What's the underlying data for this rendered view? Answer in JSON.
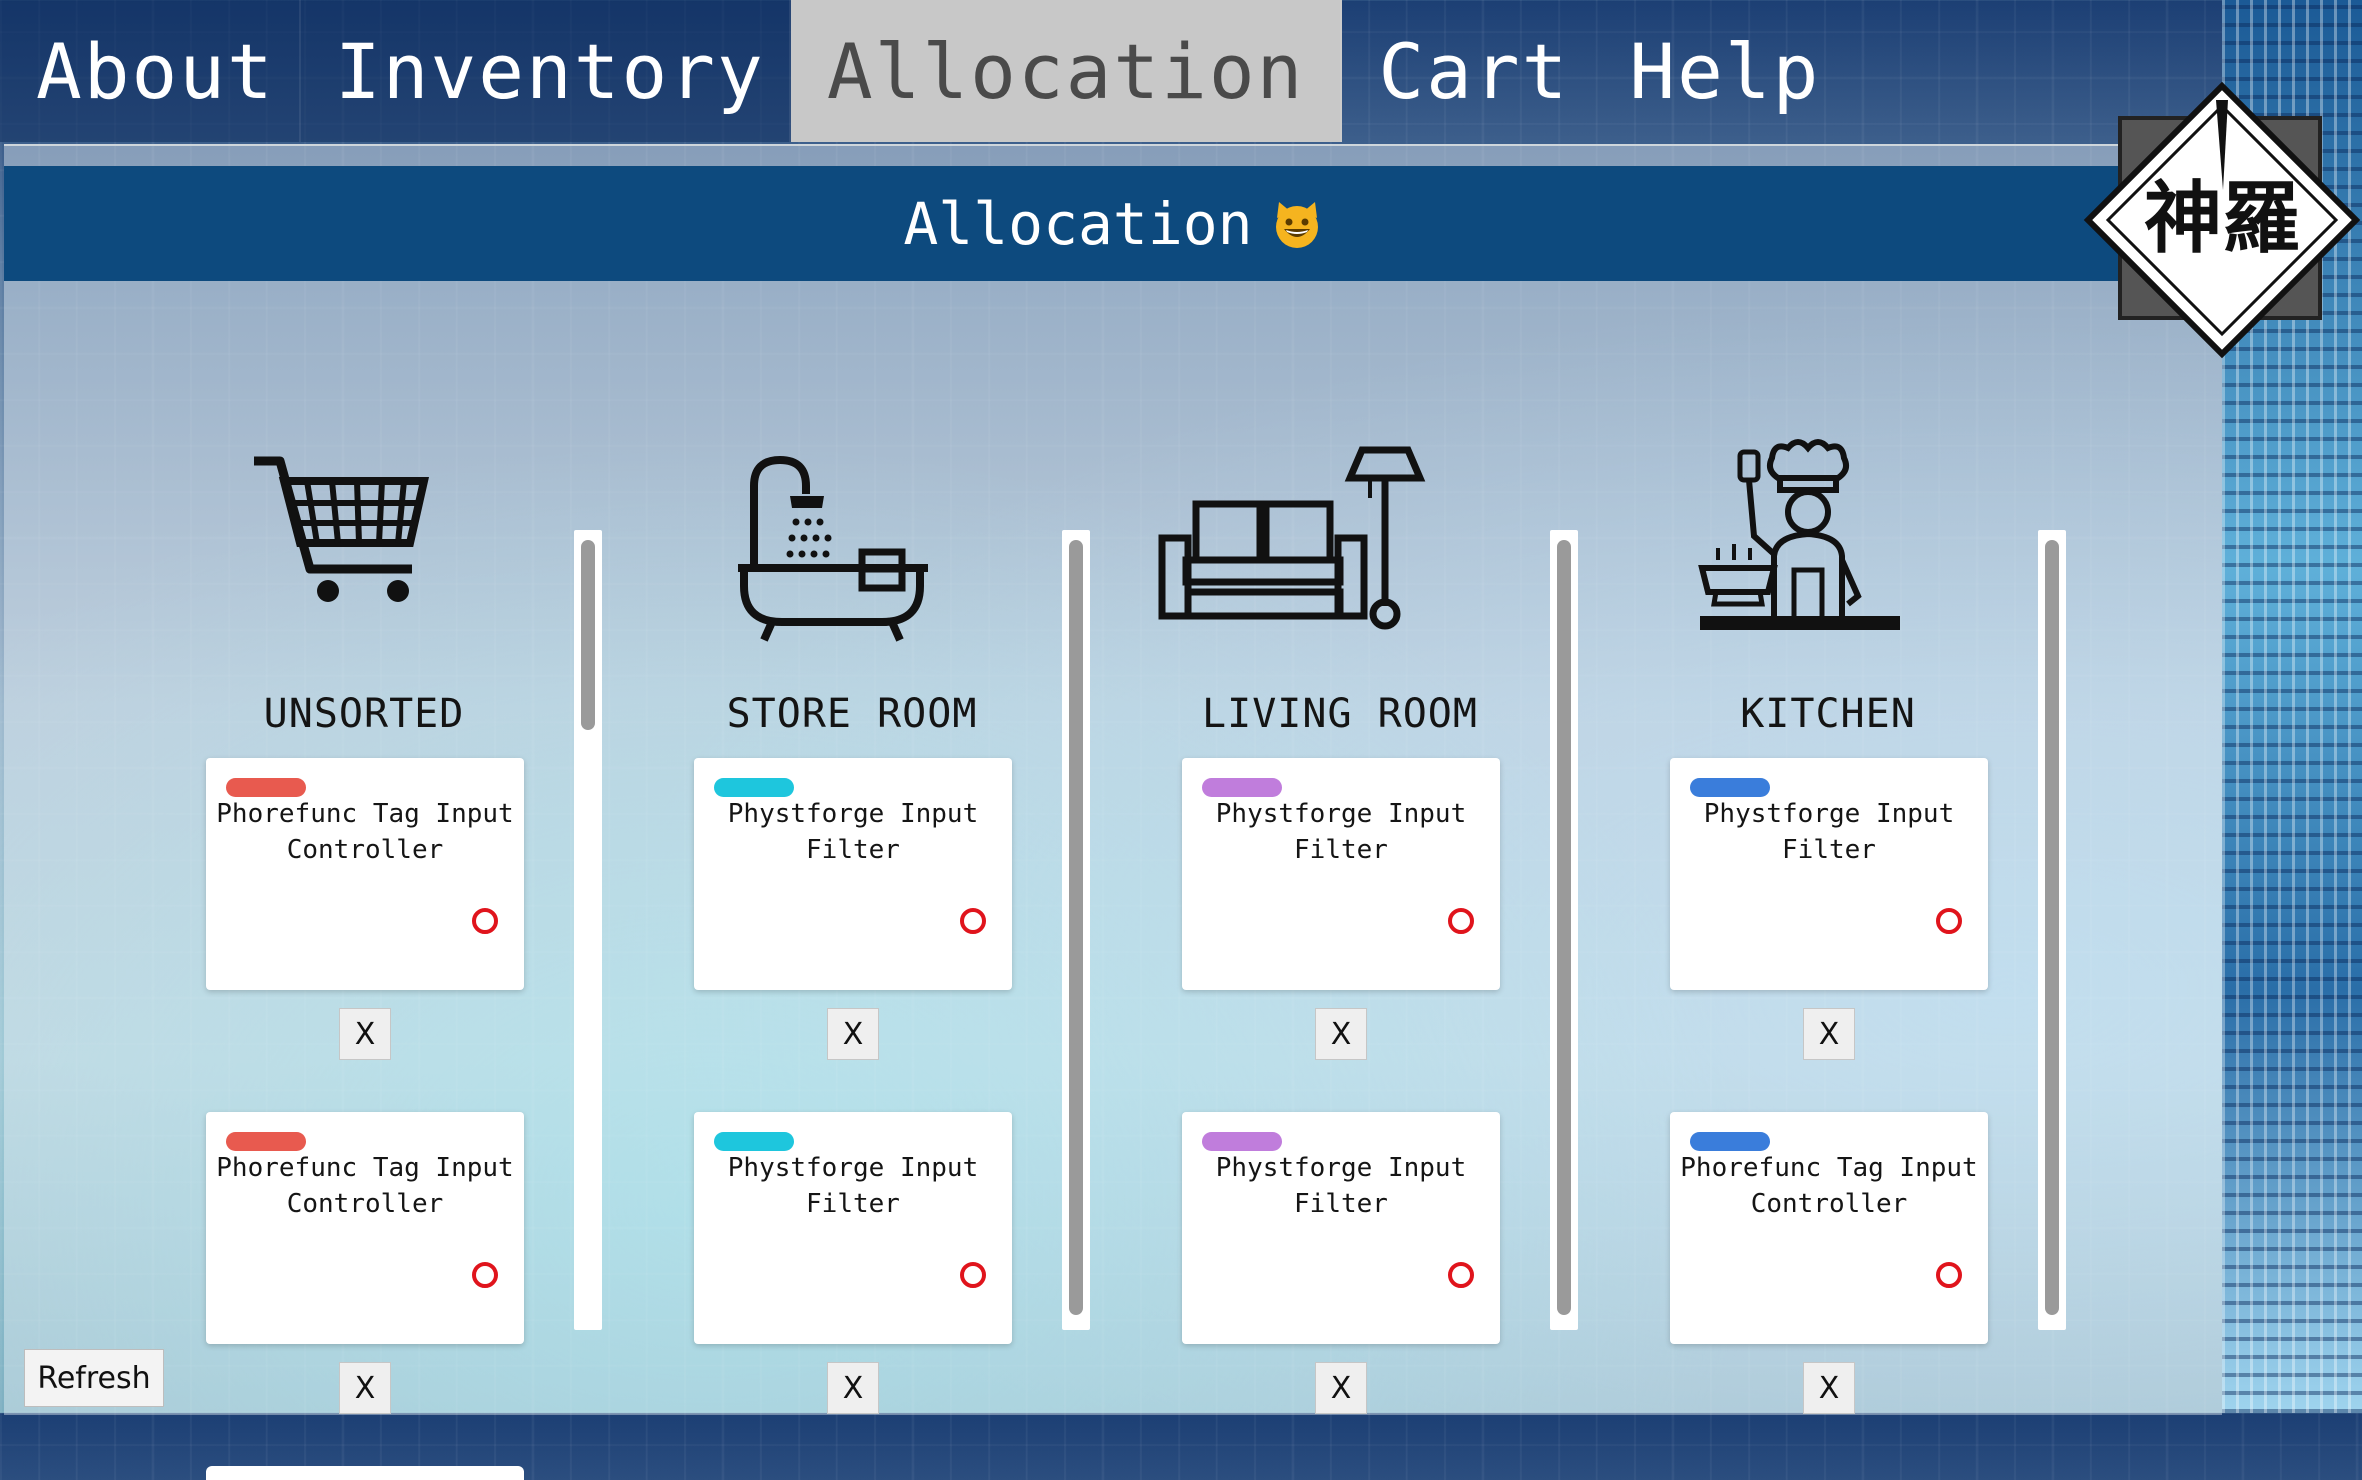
{
  "nav": {
    "tabs": [
      {
        "label": "About",
        "active": false
      },
      {
        "label": "Inventory",
        "active": false
      },
      {
        "label": "Allocation",
        "active": true
      },
      {
        "label": "Cart",
        "active": false
      },
      {
        "label": "Help",
        "active": false
      }
    ]
  },
  "header": {
    "title": "Allocation",
    "emoji": "grinning-cat"
  },
  "logo": {
    "text": "神羅"
  },
  "columns": [
    {
      "title": "UNSORTED",
      "icon": "shopping-cart-icon",
      "cards": [
        {
          "title": "Phorefunc Tag Input Controller",
          "tag_color": "#e85a4f"
        },
        {
          "title": "Phorefunc Tag Input Controller",
          "tag_color": "#e85a4f"
        }
      ]
    },
    {
      "title": "STORE ROOM",
      "icon": "bathtub-icon",
      "cards": [
        {
          "title": "Phystforge Input Filter",
          "tag_color": "#1ec6dd"
        },
        {
          "title": "Phystforge Input Filter",
          "tag_color": "#1ec6dd"
        }
      ]
    },
    {
      "title": "LIVING ROOM",
      "icon": "sofa-icon",
      "cards": [
        {
          "title": "Phystforge Input Filter",
          "tag_color": "#c07ddc"
        },
        {
          "title": "Phystforge Input Filter",
          "tag_color": "#c07ddc"
        }
      ]
    },
    {
      "title": "KITCHEN",
      "icon": "chef-icon",
      "cards": [
        {
          "title": "Phystforge Input Filter",
          "tag_color": "#3a7ddb"
        },
        {
          "title": "Phorefunc Tag Input Controller",
          "tag_color": "#3a7ddb"
        }
      ]
    }
  ],
  "remove_label": "X",
  "refresh_label": "Refresh"
}
